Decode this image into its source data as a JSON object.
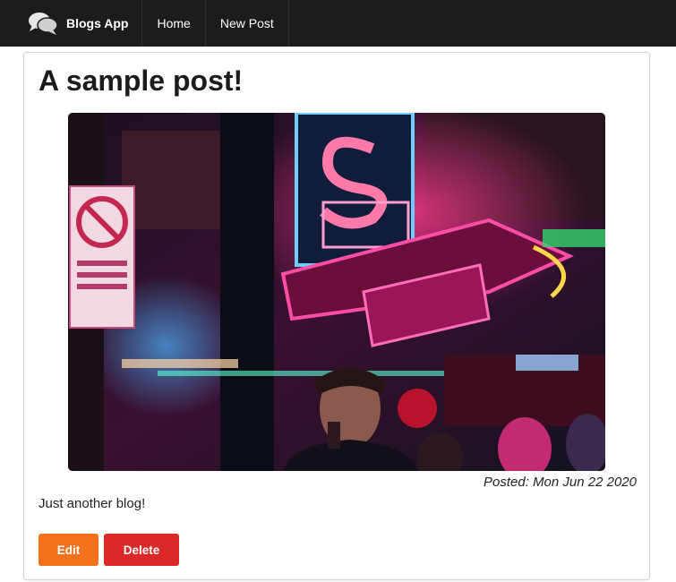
{
  "navbar": {
    "brand": "Blogs App",
    "brand_icon": "comments-icon",
    "links": [
      "Home",
      "New Post"
    ]
  },
  "post": {
    "title": "A sample post!",
    "image_alt": "neon signs street scene",
    "posted": "Posted: Mon Jun 22 2020",
    "body": "Just another blog!"
  },
  "actions": {
    "edit_label": "Edit",
    "delete_label": "Delete"
  },
  "colors": {
    "navbar_bg": "#1b1c1d",
    "edit": "#f2711c",
    "delete": "#db2828"
  }
}
